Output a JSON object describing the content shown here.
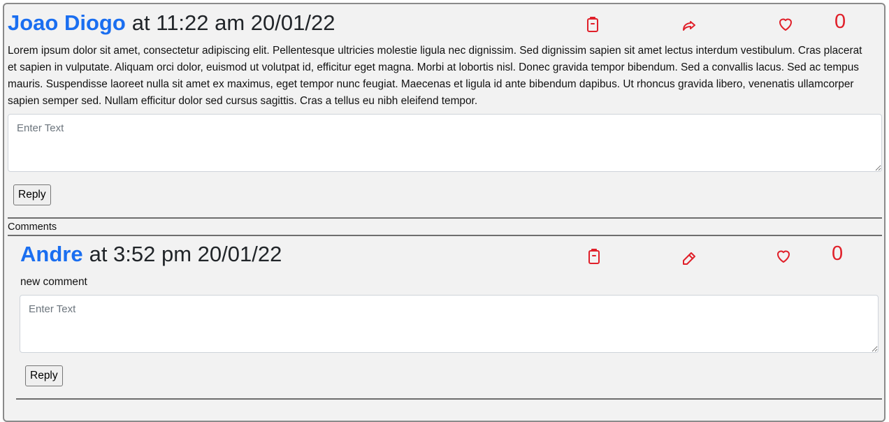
{
  "post": {
    "author": "Joao Diogo",
    "meta": "at 11:22 am 20/01/22",
    "body": "Lorem ipsum dolor sit amet, consectetur adipiscing elit. Pellentesque ultricies molestie ligula nec dignissim. Sed dignissim sapien sit amet lectus interdum vestibulum. Cras placerat et sapien in vulputate. Aliquam orci dolor, euismod ut volutpat id, efficitur eget magna. Morbi at lobortis nisl. Donec gravida tempor bibendum. Sed a convallis lacus. Sed ac tempus mauris. Suspendisse laoreet nulla sit amet ex maximus, eget tempor nunc feugiat. Maecenas et ligula id ante bibendum dapibus. Ut rhoncus gravida libero, venenatis ullamcorper sapien semper sed. Nullam efficitur dolor sed cursus sagittis. Cras a tellus eu nibh eleifend tempor.",
    "likes": "0",
    "reply_placeholder": "Enter Text",
    "reply_value": "",
    "reply_label": "Reply",
    "icons": [
      "trash-icon",
      "share-icon",
      "heart-icon"
    ]
  },
  "comments_label": "Comments",
  "comments": [
    {
      "author": "Andre",
      "meta": "at 3:52 pm 20/01/22",
      "body": "new comment",
      "likes": "0",
      "reply_placeholder": "Enter Text",
      "reply_value": "",
      "reply_label": "Reply",
      "icons": [
        "trash-icon",
        "edit-pencil-icon",
        "heart-icon"
      ]
    }
  ],
  "colors": {
    "author_link": "#1a6ef0",
    "action_icons": "#e0202a",
    "card_background": "#f2f2f2"
  }
}
